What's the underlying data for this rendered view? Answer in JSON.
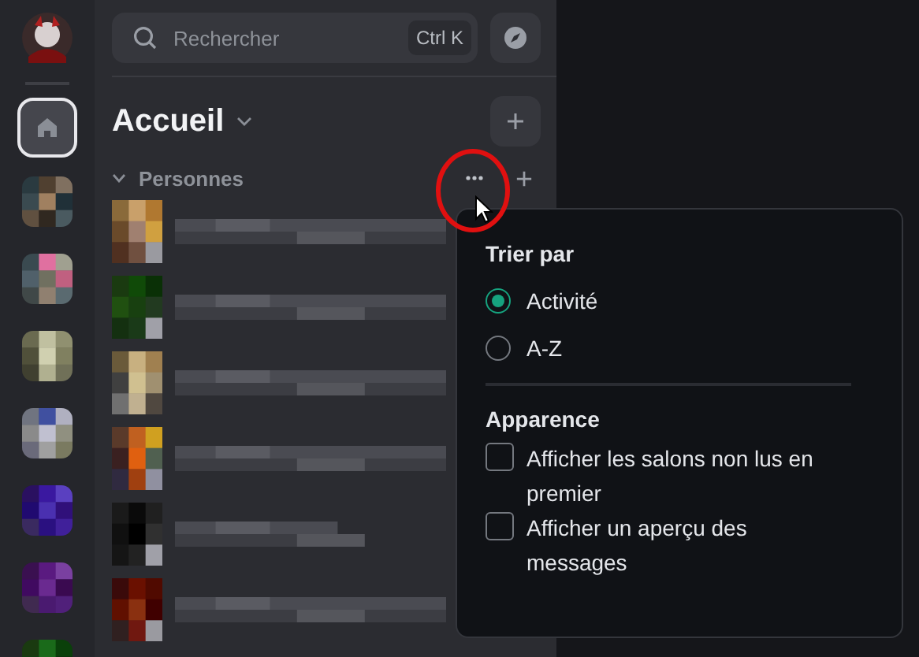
{
  "search": {
    "placeholder": "Rechercher",
    "shortcut": "Ctrl K"
  },
  "header": {
    "title": "Accueil"
  },
  "section": {
    "label": "Personnes",
    "expanded": true
  },
  "menu": {
    "sort_title": "Trier par",
    "sort_options": [
      {
        "label": "Activité",
        "selected": true
      },
      {
        "label": "A-Z",
        "selected": false
      }
    ],
    "appearance_title": "Apparence",
    "options": [
      {
        "label": "Afficher les salons non lus en premier",
        "checked": false
      },
      {
        "label": "Afficher un aperçu des messages",
        "checked": false
      }
    ]
  }
}
